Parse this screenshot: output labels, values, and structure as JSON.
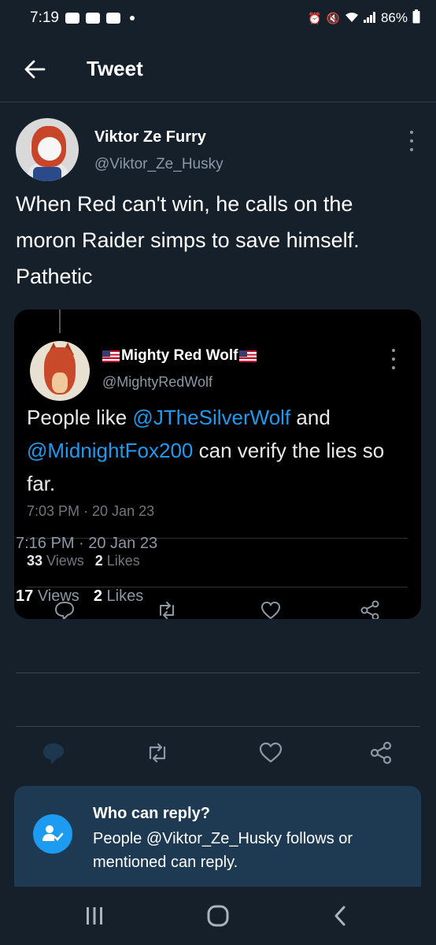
{
  "status_bar": {
    "time": "7:19",
    "battery": "86%"
  },
  "header": {
    "title": "Tweet"
  },
  "tweet": {
    "author_name": "Viktor Ze Furry",
    "author_handle": "@Viktor_Ze_Husky",
    "text": "When Red can't win, he calls on the moron Raider simps to save himself. Pathetic",
    "time": "7:16 PM · 20 Jan 23",
    "views_count": "17",
    "views_label": "Views",
    "likes_count": "2",
    "likes_label": "Likes"
  },
  "quoted_tweet": {
    "author_name": "Mighty Red Wolf",
    "author_handle": "@MightyRedWolf",
    "text_part1": "People like ",
    "mention1": "@JTheSilverWolf",
    "text_part2": " and ",
    "mention2": "@MidnightFox200",
    "text_part3": " can verify the lies so far.",
    "time": "7:03 PM · 20 Jan 23",
    "views_count": "33",
    "views_label": "Views",
    "likes_count": "2",
    "likes_label": "Likes"
  },
  "reply_settings": {
    "title": "Who can reply?",
    "description": "People @Viktor_Ze_Husky follows or mentioned can reply."
  },
  "colors": {
    "background": "#15202b",
    "accent": "#1d9bf0",
    "quote_background": "#000000",
    "reply_box": "#1e3a52"
  },
  "icons": {
    "back": "arrow-left-icon",
    "more": "more-vertical-icon",
    "reply": "comment-icon",
    "retweet": "retweet-icon",
    "like": "heart-icon",
    "share": "share-icon",
    "reply_settings": "person-check-icon"
  }
}
